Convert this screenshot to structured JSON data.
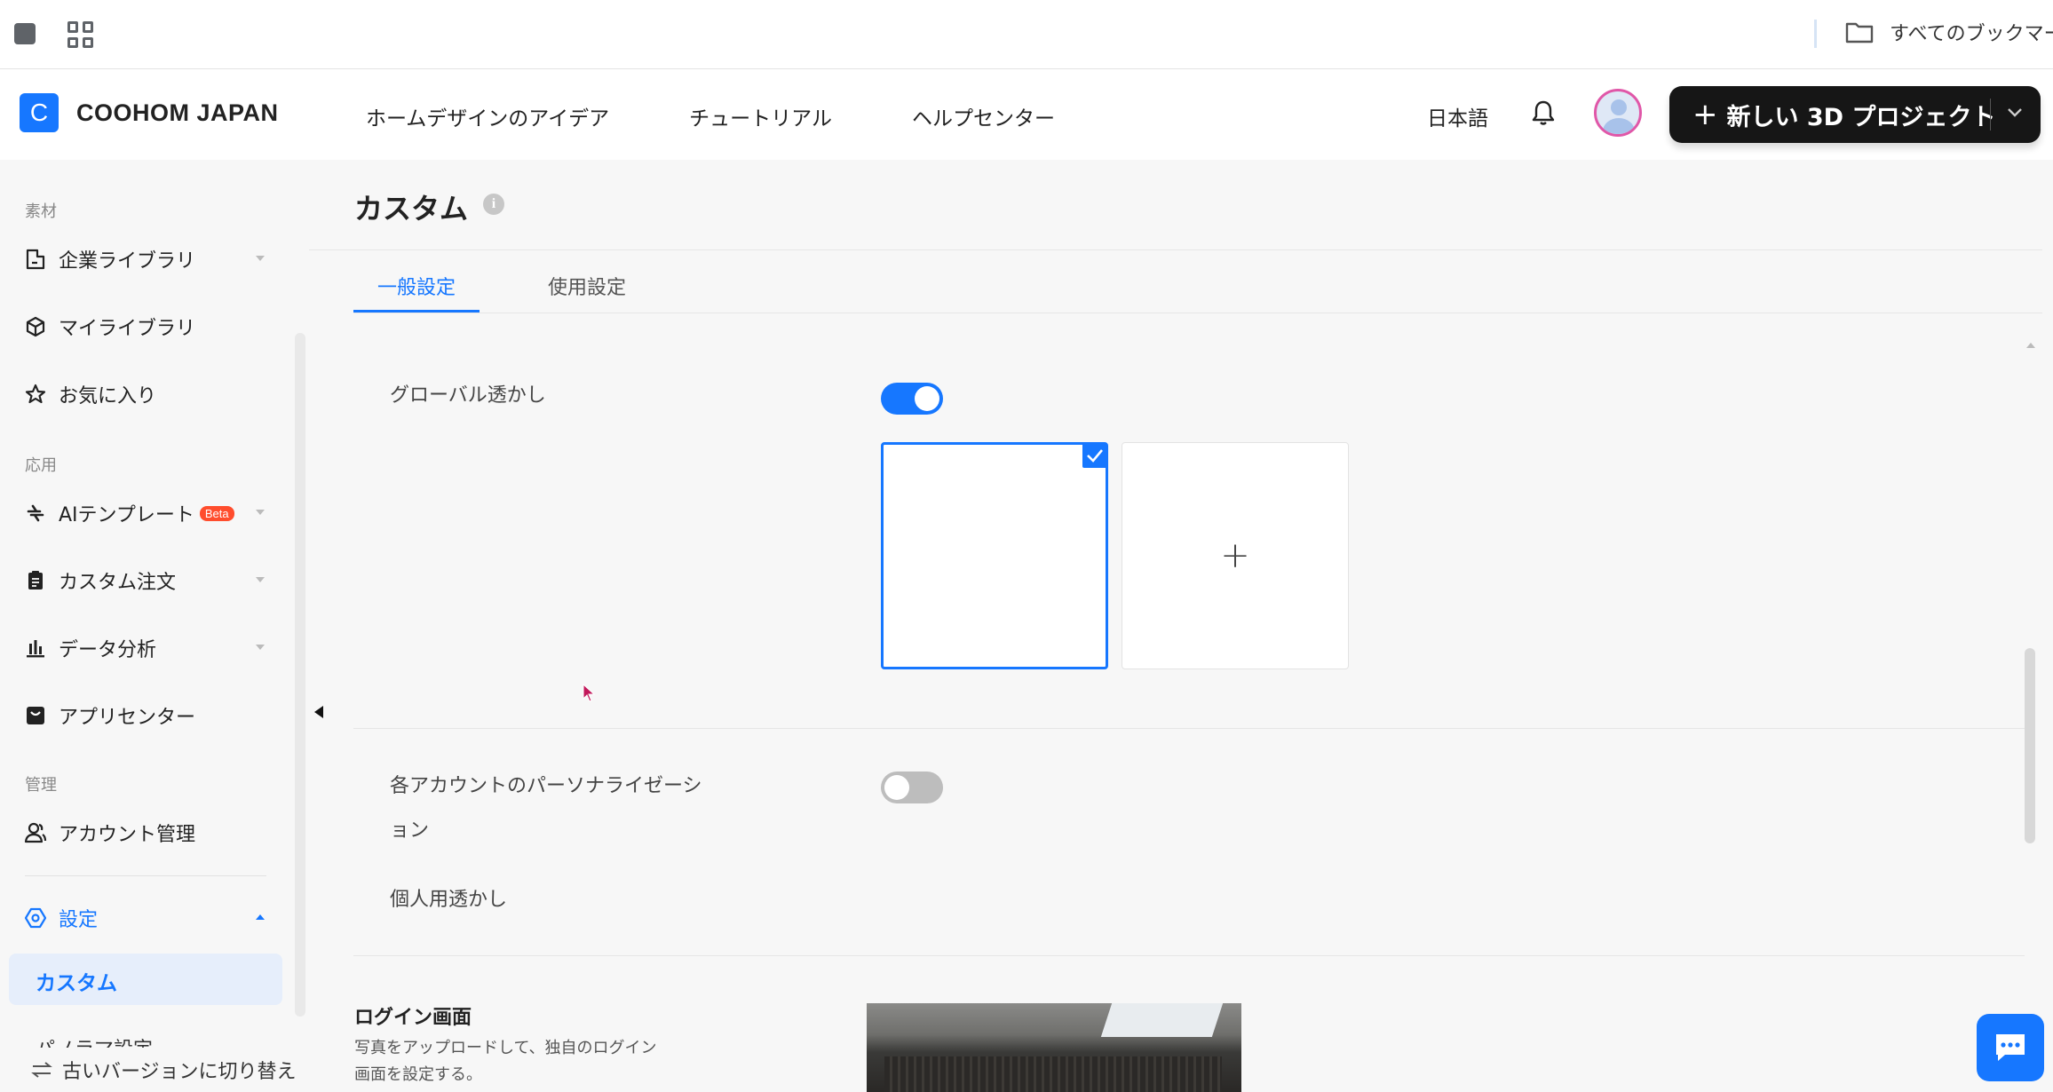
{
  "browser": {
    "bookmarks_label": "すべてのブックマーク"
  },
  "header": {
    "logo_letter": "C",
    "brand": "COOHOM JAPAN",
    "nav": [
      "ホームデザインのアイデア",
      "チュートリアル",
      "ヘルプセンター"
    ],
    "language": "日本語",
    "new_project_label": "新しい 3D プロジェクト"
  },
  "sidebar": {
    "sections": {
      "materials": "素材",
      "apps": "応用",
      "admin": "管理"
    },
    "items": [
      {
        "label": "企業ライブラリ",
        "icon": "building-library-icon",
        "expandable": true
      },
      {
        "label": "マイライブラリ",
        "icon": "cube-icon",
        "expandable": false
      },
      {
        "label": "お気に入り",
        "icon": "star-icon",
        "expandable": false
      },
      {
        "label": "AIテンプレート",
        "badge": "Beta",
        "icon": "lightning-icon",
        "expandable": true
      },
      {
        "label": "カスタム注文",
        "icon": "clipboard-icon",
        "expandable": true
      },
      {
        "label": "データ分析",
        "icon": "bar-chart-icon",
        "expandable": true
      },
      {
        "label": "アプリセンター",
        "icon": "shopping-bag-icon",
        "expandable": false
      },
      {
        "label": "アカウント管理",
        "icon": "user-group-icon",
        "expandable": false
      },
      {
        "label": "設定",
        "icon": "settings-hexagon-icon",
        "expandable": true,
        "active": true
      }
    ],
    "active_sub": "カスタム",
    "next_sub_partial": "パノラマ設定",
    "footer": "古いバージョンに切り替え"
  },
  "main": {
    "title": "カスタム",
    "tabs": [
      "一般設定",
      "使用設定"
    ],
    "active_tab": 0,
    "global_watermark": {
      "label": "グローバル透かし",
      "enabled": true,
      "add_symbol": "+"
    },
    "personalization": {
      "label_line1": "各アカウントのパーソナライゼーシ",
      "label_line2": "ョン",
      "enabled": false
    },
    "personal_watermark_label": "個人用透かし",
    "login_screen": {
      "title": "ログイン画面",
      "description_line1": "写真をアップロードして、独自のログイン",
      "description_line2": "画面を設定する。"
    }
  },
  "colors": {
    "accent": "#1677ff",
    "beta_badge": "#ff4d2d",
    "primary_button": "#161616"
  }
}
